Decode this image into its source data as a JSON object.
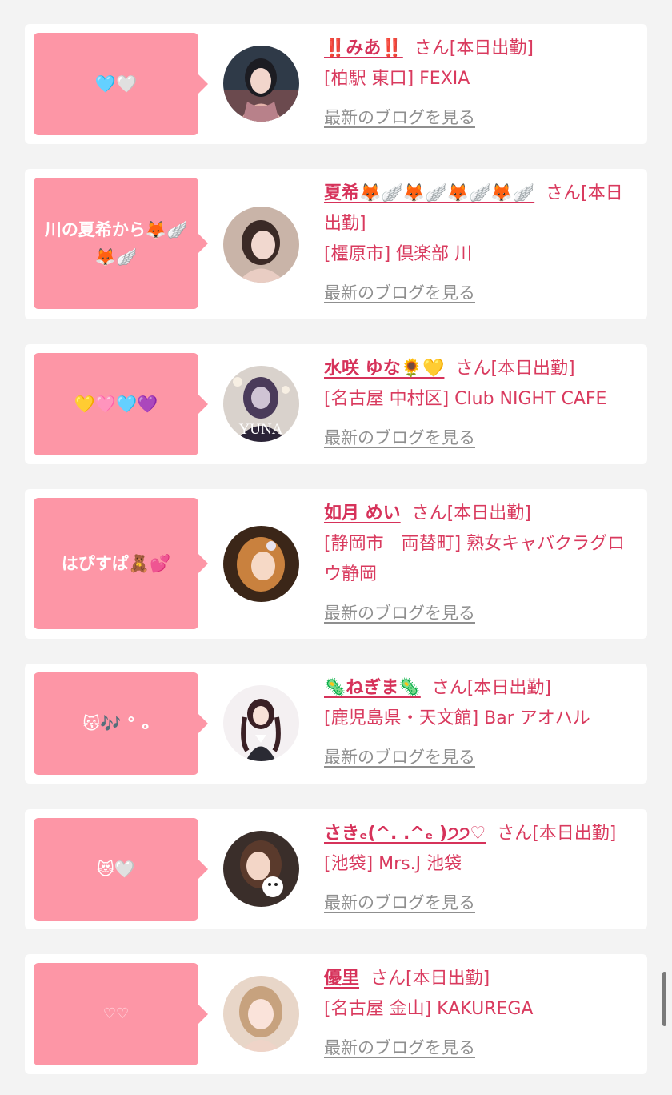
{
  "colors": {
    "page_bg": "#f3f3f3",
    "card_bg": "#ffffff",
    "bubble_bg": "#fd96a6",
    "name_color": "#d6325a",
    "shop_color": "#d93a5e",
    "blog_link_color": "#8f8f8f"
  },
  "cards": [
    {
      "bubble": "🩵🤍",
      "name": "‼️みあ‼️",
      "san": "さん[本日出勤]",
      "shop": "[柏駅 東口] FEXIA",
      "blog_link": "最新のブログを見る",
      "avatar_icon": "profile-photo"
    },
    {
      "bubble": "川の夏希から🦊🪽🦊🪽",
      "name": "夏希🦊🪽🦊🪽🦊🪽🦊🪽",
      "san": "さん[本日出勤]",
      "shop": "[橿原市] 倶楽部 川",
      "blog_link": "最新のブログを見る",
      "avatar_icon": "profile-photo"
    },
    {
      "bubble": "💛🩷🩵💜",
      "name": "水咲 ゆな🌻💛",
      "san": "さん[本日出勤]",
      "shop": "[名古屋 中村区] Club NIGHT CAFE",
      "blog_link": "最新のブログを見る",
      "avatar_icon": "profile-photo",
      "avatar_text": "YUNA"
    },
    {
      "bubble": "はぴすぱ🧸💕",
      "name": "如月 めい",
      "san": "さん[本日出勤]",
      "shop": "[静岡市　両替町] 熟女キャバクラグロウ静岡",
      "blog_link": "最新のブログを見る",
      "avatar_icon": "profile-photo"
    },
    {
      "bubble": "😽🎶 ° ₒ",
      "name": "🦠ねぎま🦠",
      "san": "さん[本日出勤]",
      "shop": "[鹿児島県・天文館] Bar アオハル",
      "blog_link": "最新のブログを見る",
      "avatar_icon": "profile-photo"
    },
    {
      "bubble": "😻🤍",
      "name": "さきₑ(^. .^ₑ )੭੭♡",
      "san": "さん[本日出勤]",
      "shop": "[池袋] Mrs.J 池袋",
      "blog_link": "最新のブログを見る",
      "avatar_icon": "profile-photo"
    },
    {
      "bubble": "♡♡",
      "name": "優里",
      "san": "さん[本日出勤]",
      "shop": "[名古屋 金山] KAKUREGA",
      "blog_link": "最新のブログを見る",
      "avatar_icon": "profile-photo"
    }
  ]
}
